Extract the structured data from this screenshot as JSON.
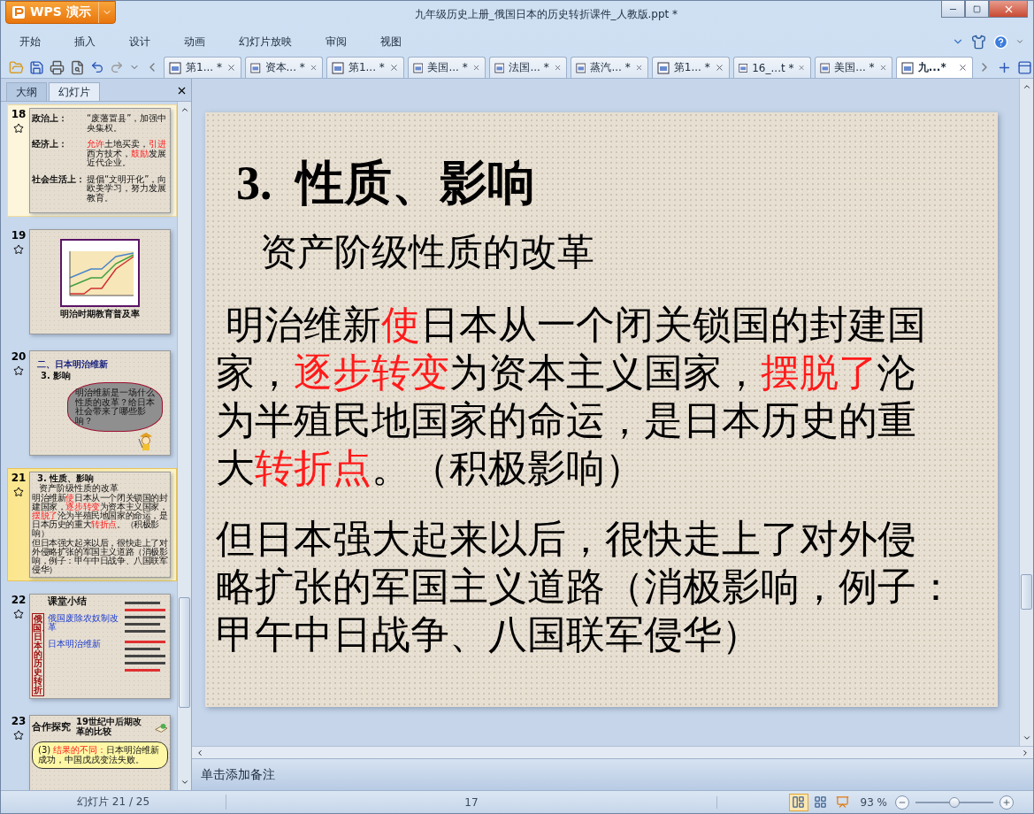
{
  "app": {
    "name": "WPS 演示"
  },
  "window": {
    "title": "九年级历史上册_俄国日本的历史转折课件_人教版.ppt *"
  },
  "menu": [
    {
      "label": "开始"
    },
    {
      "label": "插入"
    },
    {
      "label": "设计"
    },
    {
      "label": "动画"
    },
    {
      "label": "幻灯片放映"
    },
    {
      "label": "审阅"
    },
    {
      "label": "视图"
    }
  ],
  "doc_tabs": [
    {
      "label": "第1... *",
      "selected": false
    },
    {
      "label": "资本... *",
      "selected": false
    },
    {
      "label": "第1... *",
      "selected": false
    },
    {
      "label": "美国... *",
      "selected": false
    },
    {
      "label": "法国... *",
      "selected": false
    },
    {
      "label": "蒸汽... *",
      "selected": false
    },
    {
      "label": "第1... *",
      "selected": false
    },
    {
      "label": "16_...t *",
      "selected": false
    },
    {
      "label": "美国... *",
      "selected": false
    },
    {
      "label": "九...*",
      "selected": true
    }
  ],
  "panel": {
    "tabs": [
      {
        "label": "大纲",
        "selected": false
      },
      {
        "label": "幻灯片",
        "selected": true
      }
    ]
  },
  "slides": [
    {
      "number": "18",
      "kind": "rows",
      "selected": false,
      "hovered": true,
      "rows": [
        {
          "label": "政治上：",
          "segments": [
            {
              "text": "“废藩置县”，加强中央集权。",
              "highlight": false
            }
          ]
        },
        {
          "label": "经济上：",
          "segments": [
            {
              "text": "允许",
              "highlight": true
            },
            {
              "text": "土地买卖，",
              "highlight": false
            },
            {
              "text": "引进",
              "highlight": true
            },
            {
              "text": "西方技术，",
              "highlight": false
            },
            {
              "text": "鼓励",
              "highlight": true
            },
            {
              "text": "发展近代企业。",
              "highlight": false
            }
          ]
        },
        {
          "label": "社会生活上：",
          "segments": [
            {
              "text": "提倡“文明开化”，向欧美学习，努力发展教育。",
              "highlight": false
            }
          ]
        }
      ]
    },
    {
      "number": "19",
      "kind": "chart",
      "selected": false,
      "hovered": false,
      "caption": "明治时期教育普及率"
    },
    {
      "number": "20",
      "kind": "question",
      "selected": false,
      "hovered": false,
      "heading": "二、日本明治维新",
      "subheading": "3. 影响",
      "cloud": "明治维新是一场什么性质的改革？给日本社会带来了哪些影响？"
    },
    {
      "number": "21",
      "kind": "text",
      "selected": true,
      "hovered": false,
      "title": "3. 性质、影响",
      "subtitle": "资产阶级性质的改革",
      "paragraphs": [
        [
          {
            "text": "明治维新",
            "highlight": false
          },
          {
            "text": "使",
            "highlight": true
          },
          {
            "text": "日本从一个闭关锁国的封建国家，",
            "highlight": false
          },
          {
            "text": "逐步转变",
            "highlight": true
          },
          {
            "text": "为资本主义国家，",
            "highlight": false
          },
          {
            "text": "摆脱了",
            "highlight": true
          },
          {
            "text": "沦为半殖民地国家的命运，是日本历史的重大",
            "highlight": false
          },
          {
            "text": "转折点",
            "highlight": true
          },
          {
            "text": "。（积极影响）",
            "highlight": false
          }
        ],
        [
          {
            "text": "但日本强大起来以后，很快走上了对外侵略扩张的军国主义道路（消极影响，例子：甲午中日战争、八国联军侵华）",
            "highlight": false
          }
        ]
      ]
    },
    {
      "number": "22",
      "kind": "summary",
      "selected": false,
      "hovered": false,
      "title": "课堂小结",
      "side_title": "俄国、日本的历史转折",
      "branches": [
        "俄国废除农奴制改革",
        "日本明治维新"
      ]
    },
    {
      "number": "23",
      "kind": "compare",
      "selected": false,
      "hovered": false,
      "title": "合作探究",
      "subtitle": "19世纪中后期改革的比较",
      "segments": [
        {
          "text": "(3) ",
          "highlight": false
        },
        {
          "text": "结果的不同：",
          "highlight": true
        },
        {
          "text": "日本明治维新成功，中国戊戌变法失败。",
          "highlight": false
        }
      ]
    }
  ],
  "slide": {
    "title": "3.  性质、影响",
    "subtitle": "资产阶级性质的改革",
    "paragraphs": [
      [
        [
          {
            "text": " 明治维新",
            "highlight": false
          },
          {
            "text": "使",
            "highlight": true
          },
          {
            "text": "日本从一个闭关锁国的封建国",
            "highlight": false
          }
        ],
        [
          {
            "text": "家，",
            "highlight": false
          },
          {
            "text": "逐步转变",
            "highlight": true
          },
          {
            "text": "为资本主义国家，",
            "highlight": false
          },
          {
            "text": "摆脱了",
            "highlight": true
          },
          {
            "text": "沦",
            "highlight": false
          }
        ],
        [
          {
            "text": "为半殖民地国家的命运，是日本历史的重",
            "highlight": false
          }
        ],
        [
          {
            "text": "大",
            "highlight": false
          },
          {
            "text": "转折点",
            "highlight": true
          },
          {
            "text": "。（积极影响）",
            "highlight": false
          }
        ]
      ],
      [
        [
          {
            "text": "但日本强大起来以后，很快走上了对外侵",
            "highlight": false
          }
        ],
        [
          {
            "text": "略扩张的军国主义道路（消极影响，例子：",
            "highlight": false
          }
        ],
        [
          {
            "text": "甲午中日战争、八国联军侵华）",
            "highlight": false
          }
        ]
      ]
    ]
  },
  "notes": {
    "placeholder": "单击添加备注"
  },
  "status": {
    "slide_counter": "幻灯片 21 / 25",
    "field_2": "17",
    "zoom": "93 %",
    "zoom_slider": {
      "level": 0.5
    },
    "views": [
      {
        "selected": true
      },
      {
        "selected": false
      },
      {
        "selected": false
      }
    ]
  }
}
